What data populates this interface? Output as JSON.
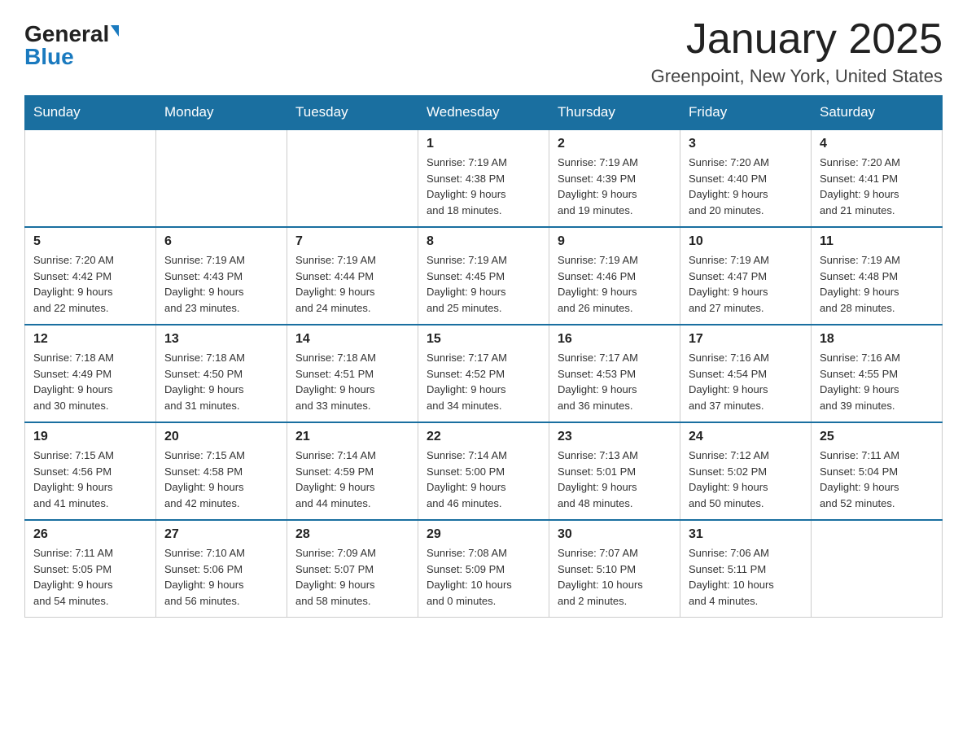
{
  "header": {
    "logo_general": "General",
    "logo_blue": "Blue",
    "title": "January 2025",
    "subtitle": "Greenpoint, New York, United States"
  },
  "weekdays": [
    "Sunday",
    "Monday",
    "Tuesday",
    "Wednesday",
    "Thursday",
    "Friday",
    "Saturday"
  ],
  "weeks": [
    [
      {
        "day": "",
        "info": ""
      },
      {
        "day": "",
        "info": ""
      },
      {
        "day": "",
        "info": ""
      },
      {
        "day": "1",
        "info": "Sunrise: 7:19 AM\nSunset: 4:38 PM\nDaylight: 9 hours\nand 18 minutes."
      },
      {
        "day": "2",
        "info": "Sunrise: 7:19 AM\nSunset: 4:39 PM\nDaylight: 9 hours\nand 19 minutes."
      },
      {
        "day": "3",
        "info": "Sunrise: 7:20 AM\nSunset: 4:40 PM\nDaylight: 9 hours\nand 20 minutes."
      },
      {
        "day": "4",
        "info": "Sunrise: 7:20 AM\nSunset: 4:41 PM\nDaylight: 9 hours\nand 21 minutes."
      }
    ],
    [
      {
        "day": "5",
        "info": "Sunrise: 7:20 AM\nSunset: 4:42 PM\nDaylight: 9 hours\nand 22 minutes."
      },
      {
        "day": "6",
        "info": "Sunrise: 7:19 AM\nSunset: 4:43 PM\nDaylight: 9 hours\nand 23 minutes."
      },
      {
        "day": "7",
        "info": "Sunrise: 7:19 AM\nSunset: 4:44 PM\nDaylight: 9 hours\nand 24 minutes."
      },
      {
        "day": "8",
        "info": "Sunrise: 7:19 AM\nSunset: 4:45 PM\nDaylight: 9 hours\nand 25 minutes."
      },
      {
        "day": "9",
        "info": "Sunrise: 7:19 AM\nSunset: 4:46 PM\nDaylight: 9 hours\nand 26 minutes."
      },
      {
        "day": "10",
        "info": "Sunrise: 7:19 AM\nSunset: 4:47 PM\nDaylight: 9 hours\nand 27 minutes."
      },
      {
        "day": "11",
        "info": "Sunrise: 7:19 AM\nSunset: 4:48 PM\nDaylight: 9 hours\nand 28 minutes."
      }
    ],
    [
      {
        "day": "12",
        "info": "Sunrise: 7:18 AM\nSunset: 4:49 PM\nDaylight: 9 hours\nand 30 minutes."
      },
      {
        "day": "13",
        "info": "Sunrise: 7:18 AM\nSunset: 4:50 PM\nDaylight: 9 hours\nand 31 minutes."
      },
      {
        "day": "14",
        "info": "Sunrise: 7:18 AM\nSunset: 4:51 PM\nDaylight: 9 hours\nand 33 minutes."
      },
      {
        "day": "15",
        "info": "Sunrise: 7:17 AM\nSunset: 4:52 PM\nDaylight: 9 hours\nand 34 minutes."
      },
      {
        "day": "16",
        "info": "Sunrise: 7:17 AM\nSunset: 4:53 PM\nDaylight: 9 hours\nand 36 minutes."
      },
      {
        "day": "17",
        "info": "Sunrise: 7:16 AM\nSunset: 4:54 PM\nDaylight: 9 hours\nand 37 minutes."
      },
      {
        "day": "18",
        "info": "Sunrise: 7:16 AM\nSunset: 4:55 PM\nDaylight: 9 hours\nand 39 minutes."
      }
    ],
    [
      {
        "day": "19",
        "info": "Sunrise: 7:15 AM\nSunset: 4:56 PM\nDaylight: 9 hours\nand 41 minutes."
      },
      {
        "day": "20",
        "info": "Sunrise: 7:15 AM\nSunset: 4:58 PM\nDaylight: 9 hours\nand 42 minutes."
      },
      {
        "day": "21",
        "info": "Sunrise: 7:14 AM\nSunset: 4:59 PM\nDaylight: 9 hours\nand 44 minutes."
      },
      {
        "day": "22",
        "info": "Sunrise: 7:14 AM\nSunset: 5:00 PM\nDaylight: 9 hours\nand 46 minutes."
      },
      {
        "day": "23",
        "info": "Sunrise: 7:13 AM\nSunset: 5:01 PM\nDaylight: 9 hours\nand 48 minutes."
      },
      {
        "day": "24",
        "info": "Sunrise: 7:12 AM\nSunset: 5:02 PM\nDaylight: 9 hours\nand 50 minutes."
      },
      {
        "day": "25",
        "info": "Sunrise: 7:11 AM\nSunset: 5:04 PM\nDaylight: 9 hours\nand 52 minutes."
      }
    ],
    [
      {
        "day": "26",
        "info": "Sunrise: 7:11 AM\nSunset: 5:05 PM\nDaylight: 9 hours\nand 54 minutes."
      },
      {
        "day": "27",
        "info": "Sunrise: 7:10 AM\nSunset: 5:06 PM\nDaylight: 9 hours\nand 56 minutes."
      },
      {
        "day": "28",
        "info": "Sunrise: 7:09 AM\nSunset: 5:07 PM\nDaylight: 9 hours\nand 58 minutes."
      },
      {
        "day": "29",
        "info": "Sunrise: 7:08 AM\nSunset: 5:09 PM\nDaylight: 10 hours\nand 0 minutes."
      },
      {
        "day": "30",
        "info": "Sunrise: 7:07 AM\nSunset: 5:10 PM\nDaylight: 10 hours\nand 2 minutes."
      },
      {
        "day": "31",
        "info": "Sunrise: 7:06 AM\nSunset: 5:11 PM\nDaylight: 10 hours\nand 4 minutes."
      },
      {
        "day": "",
        "info": ""
      }
    ]
  ],
  "colors": {
    "header_bg": "#1a6fa0",
    "header_text": "#ffffff",
    "border": "#cccccc",
    "accent": "#1a7abf"
  }
}
